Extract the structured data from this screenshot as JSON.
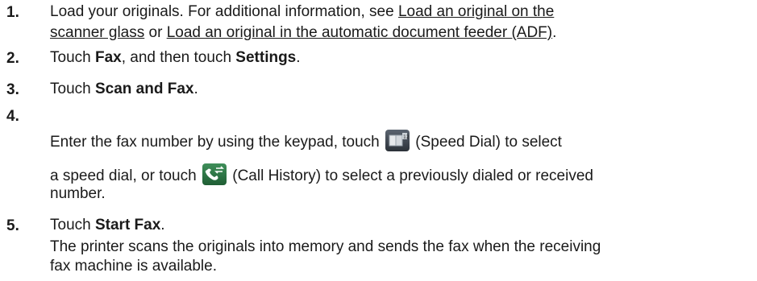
{
  "steps": [
    {
      "number": "1.",
      "lines": [
        {
          "parts": [
            {
              "text": "Load your originals. For additional information, see ",
              "style": "normal"
            },
            {
              "text": "Load an original on the",
              "style": "link"
            }
          ]
        },
        {
          "parts": [
            {
              "text": "scanner glass",
              "style": "link"
            },
            {
              "text": " or ",
              "style": "normal"
            },
            {
              "text": "Load an original in the automatic document feeder (ADF)",
              "style": "link"
            },
            {
              "text": ".",
              "style": "normal"
            }
          ]
        }
      ]
    },
    {
      "number": "2.",
      "lines": [
        {
          "parts": [
            {
              "text": "Touch ",
              "style": "normal"
            },
            {
              "text": "Fax",
              "style": "bold"
            },
            {
              "text": ", and then touch ",
              "style": "normal"
            },
            {
              "text": "Settings",
              "style": "bold"
            },
            {
              "text": ".",
              "style": "normal"
            }
          ]
        }
      ]
    },
    {
      "number": "3.",
      "lines": [
        {
          "parts": [
            {
              "text": "Touch ",
              "style": "normal"
            },
            {
              "text": "Scan and Fax",
              "style": "bold"
            },
            {
              "text": ".",
              "style": "normal"
            }
          ]
        }
      ]
    },
    {
      "number": "4.",
      "lines": [
        {
          "parts": [
            {
              "text": "Enter the fax number by using the keypad, touch ",
              "style": "normal"
            },
            {
              "icon": "speed-dial-icon"
            },
            {
              "text": " (Speed Dial) to select",
              "style": "normal"
            }
          ]
        },
        {
          "parts": [
            {
              "text": "a speed dial, or touch ",
              "style": "normal"
            },
            {
              "icon": "call-history-icon"
            },
            {
              "text": " (Call History) to select a previously dialed or received",
              "style": "normal"
            }
          ]
        },
        {
          "parts": [
            {
              "text": "number.",
              "style": "normal"
            }
          ]
        }
      ]
    },
    {
      "number": "5.",
      "lines": [
        {
          "parts": [
            {
              "text": "Touch ",
              "style": "normal"
            },
            {
              "text": "Start Fax",
              "style": "bold"
            },
            {
              "text": ".",
              "style": "normal"
            }
          ]
        },
        {
          "parts": [
            {
              "text": "The printer scans the originals into memory and sends the fax when the receiving",
              "style": "normal"
            }
          ]
        },
        {
          "parts": [
            {
              "text": "fax machine is available.",
              "style": "normal"
            }
          ]
        }
      ]
    }
  ],
  "icons": {
    "speed-dial-icon": {
      "label": "Speed Dial",
      "color": "#3a4048"
    },
    "call-history-icon": {
      "label": "Call History",
      "color": "#2f7a46"
    }
  }
}
